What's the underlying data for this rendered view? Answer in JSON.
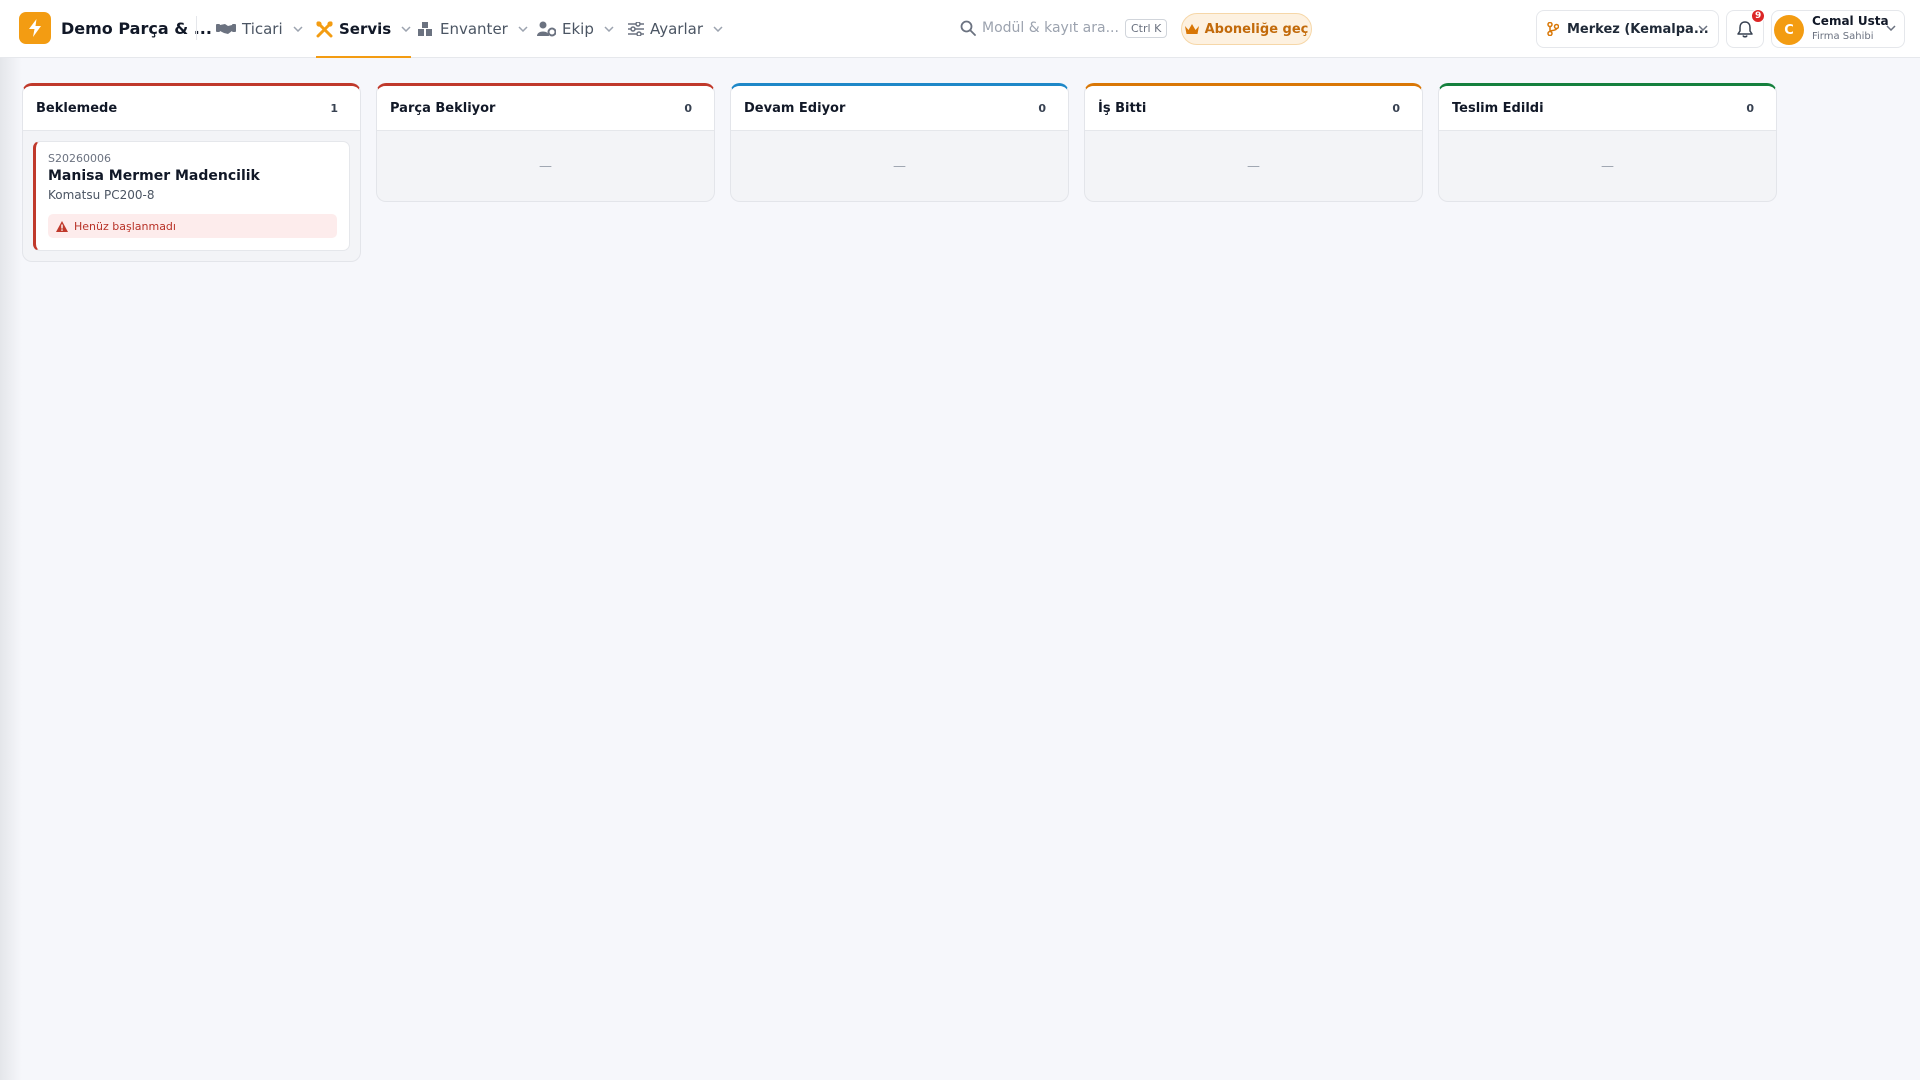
{
  "header": {
    "app_title": "Demo Parça & ...",
    "nav": [
      {
        "label": "Ticari",
        "icon": "handshake-icon"
      },
      {
        "label": "Servis",
        "icon": "tools-icon",
        "active": true
      },
      {
        "label": "Envanter",
        "icon": "warehouse-icon"
      },
      {
        "label": "Ekip",
        "icon": "user-gear-icon"
      },
      {
        "label": "Ayarlar",
        "icon": "sliders-icon"
      }
    ],
    "search": {
      "placeholder": "Modül & kayıt ara...",
      "shortcut": "Ctrl K"
    },
    "subscribe_label": "Aboneliğe geç",
    "branch_label": "Merkez (Kemalpa...",
    "notifications_count": "9",
    "user": {
      "initial": "C",
      "name": "Cemal Usta",
      "role": "Firma Sahibi"
    }
  },
  "colors": {
    "accent": "#f39c12",
    "col_waiting": "#c0392b",
    "col_parts": "#c0392b",
    "col_progress": "#1e88c8",
    "col_done": "#d97706",
    "col_delivered": "#15803d"
  },
  "board": {
    "columns": [
      {
        "title": "Beklemede",
        "count": "1",
        "color": "#c0392b",
        "empty": ""
      },
      {
        "title": "Parça Bekliyor",
        "count": "0",
        "color": "#c0392b",
        "empty": "—"
      },
      {
        "title": "Devam Ediyor",
        "count": "0",
        "color": "#1e88c8",
        "empty": "—"
      },
      {
        "title": "İş Bitti",
        "count": "0",
        "color": "#d97706",
        "empty": "—"
      },
      {
        "title": "Teslim Edildi",
        "count": "0",
        "color": "#15803d",
        "empty": "—"
      }
    ],
    "card": {
      "code": "S20260006",
      "customer": "Manisa Mermer Madencilik",
      "machine": "Komatsu PC200-8",
      "status": "Henüz başlanmadı"
    }
  }
}
